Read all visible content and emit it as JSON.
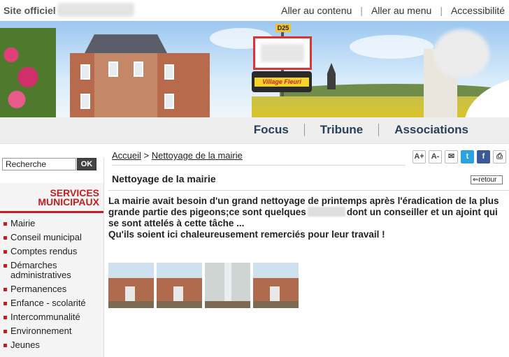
{
  "topbar": {
    "site_label": "Site officiel -",
    "links": [
      "Aller au contenu",
      "Aller au menu",
      "Accessibilité"
    ]
  },
  "banner": {
    "road_sign": "D25",
    "village_sign": "Village Fleuri"
  },
  "main_nav": [
    "Focus",
    "Tribune",
    "Associations"
  ],
  "search": {
    "value": "Recherche",
    "button": "OK"
  },
  "sidebar": {
    "title_line1": "SERVICES",
    "title_line2": "MUNICIPAUX",
    "items": [
      "Mairie",
      "Conseil municipal",
      "Comptes rendus",
      "Démarches administratives",
      "Permanences",
      "Enfance - scolarité",
      "Intercommunalité",
      "Environnement",
      "Jeunes"
    ]
  },
  "breadcrumb": {
    "home": "Accueil",
    "separator": ">",
    "current": "Nettoyage de la mairie"
  },
  "tools": {
    "font_increase": "A+",
    "font_decrease": "A-"
  },
  "article": {
    "title": "Nettoyage de la mairie",
    "back": "retour",
    "paragraph_part1": "La mairie avait besoin d'un grand nettoyage de printemps après l'éradication de la plus grande partie des pigeons;ce sont quelques",
    "paragraph_part2": "dont un conseiller et un ajoint qui se sont attelés à cette tâche ...",
    "paragraph_line3": "Qu'ils soient ici chaleureusement remerciés pour leur travail !"
  },
  "colors": {
    "accent_red": "#c41e1e",
    "nav_blue": "#2a3f5a"
  }
}
